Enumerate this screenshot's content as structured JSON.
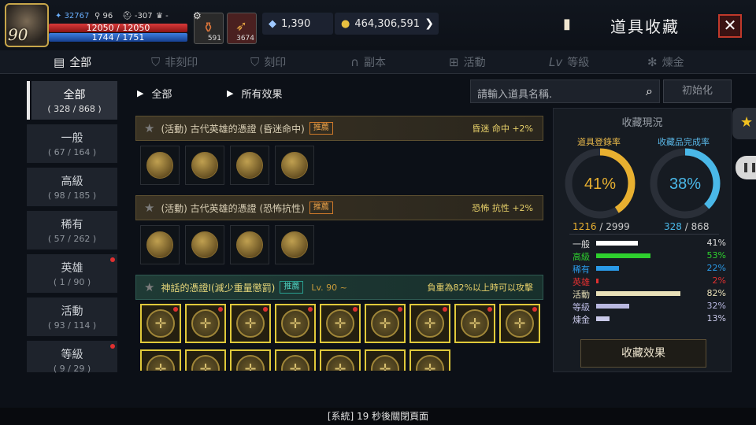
{
  "player": {
    "level": "90",
    "exp": "32767",
    "stat1": "96",
    "stat2": "-307",
    "stat3": "-",
    "hp": "12050 / 12050",
    "mp": "1744 / 1751"
  },
  "slots": [
    {
      "icon": "potion-icon",
      "count": "591"
    },
    {
      "icon": "horn-icon",
      "count": "3674"
    }
  ],
  "currency": {
    "crystal": "1,390",
    "gold": "464,306,591"
  },
  "header": {
    "title": "道具收藏",
    "close": "✕"
  },
  "tabs": [
    {
      "label": "全部",
      "icon": "book-icon",
      "active": true
    },
    {
      "label": "非刻印",
      "icon": "unseal-icon"
    },
    {
      "label": "刻印",
      "icon": "seal-icon"
    },
    {
      "label": "副本",
      "icon": "dungeon-icon"
    },
    {
      "label": "活動",
      "icon": "gift-icon"
    },
    {
      "label": "等級",
      "icon": "lv-icon"
    },
    {
      "label": "煉金",
      "icon": "alchemy-icon"
    }
  ],
  "sidebar": [
    {
      "label": "全部",
      "count": "( 328 / 868 )",
      "active": true
    },
    {
      "label": "一般",
      "count": "( 67 / 164 )"
    },
    {
      "label": "高級",
      "count": "( 98 / 185 )"
    },
    {
      "label": "稀有",
      "count": "( 57 / 262 )"
    },
    {
      "label": "英雄",
      "count": "( 1 / 90 )",
      "dot": true
    },
    {
      "label": "活動",
      "count": "( 93 / 114 )"
    },
    {
      "label": "等級",
      "count": "( 9 / 29 )",
      "dot": true
    }
  ],
  "filter": {
    "crumb1": "全部",
    "crumb2": "所有效果",
    "search_placeholder": "請輸入道具名稱.",
    "reset": "初始化"
  },
  "groups": [
    {
      "title": "(活動) 古代英雄的憑證 (昏迷命中)",
      "tag": "推薦",
      "effect": "昏迷 命中 +2%"
    },
    {
      "title": "(活動) 古代英雄的憑證 (恐怖抗性)",
      "tag": "推薦",
      "effect": "恐怖 抗性 +2%"
    },
    {
      "title": "神話的憑證I(減少重量懲罰)",
      "tag": "推薦",
      "level": "Lv. 90 ~",
      "effect": "負重為82%以上時可以攻擊"
    }
  ],
  "panel": {
    "title": "收藏現況",
    "reg_label": "道具登錄率",
    "comp_label": "收藏品完成率",
    "reg_pct": "41%",
    "comp_pct": "38%",
    "reg_value": 0.41,
    "comp_value": 0.38,
    "reg_count": "1216",
    "reg_total": "/ 2999",
    "comp_count": "328",
    "comp_total": "/ 868",
    "button": "收藏效果",
    "categories": [
      {
        "name": "一般",
        "pct": "41%",
        "value": 0.41,
        "color": "#ffffff"
      },
      {
        "name": "高級",
        "pct": "53%",
        "value": 0.53,
        "color": "#2ed02e"
      },
      {
        "name": "稀有",
        "pct": "22%",
        "value": 0.22,
        "color": "#2a9ae8"
      },
      {
        "name": "英雄",
        "pct": "2%",
        "value": 0.02,
        "color": "#e03030"
      },
      {
        "name": "活動",
        "pct": "82%",
        "value": 0.82,
        "color": "#e8e0b8"
      },
      {
        "name": "等級",
        "pct": "32%",
        "value": 0.32,
        "color": "#b8b8e0"
      },
      {
        "name": "煉金",
        "pct": "13%",
        "value": 0.13,
        "color": "#c8c8e8"
      }
    ]
  },
  "system": "[系統] 19 秒後關閉頁面"
}
